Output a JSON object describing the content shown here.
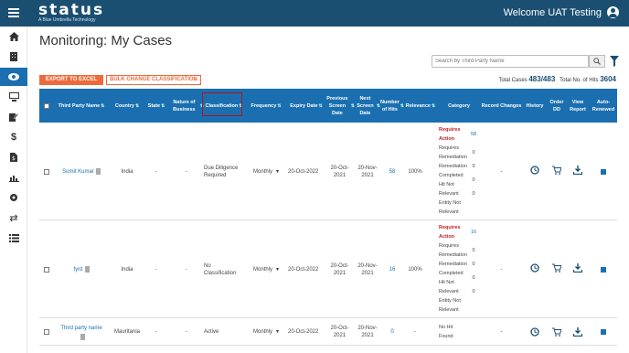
{
  "app": {
    "logo_text": "status",
    "logo_tagline": "A Blue Umbrella Technology",
    "welcome": "Welcome UAT Testing"
  },
  "sidebar": {
    "items": [
      {
        "icon": "home-icon",
        "active": false
      },
      {
        "icon": "building-icon",
        "active": false
      },
      {
        "icon": "eye-icon",
        "active": true
      },
      {
        "icon": "monitor-icon",
        "active": false
      },
      {
        "icon": "edit-document-icon",
        "active": false
      },
      {
        "icon": "dollar-icon",
        "active": false
      },
      {
        "icon": "file-dollar-icon",
        "active": false
      },
      {
        "icon": "bar-chart-icon",
        "active": false
      },
      {
        "icon": "settings-icon",
        "active": false
      },
      {
        "icon": "swap-icon",
        "active": false
      },
      {
        "icon": "list-check-icon",
        "active": false
      }
    ]
  },
  "page": {
    "title": "Monitoring: My Cases"
  },
  "search": {
    "placeholder": "Search by Third Party Name"
  },
  "toolbar": {
    "export_label": "EXPORT TO EXCEL",
    "bulk_label": "BULK CHANGE CLASSIFICATION"
  },
  "totals": {
    "cases_label": "Total Cases",
    "cases_value": "483/483",
    "hits_label": "Total No. of Hits",
    "hits_value": "3604"
  },
  "table": {
    "headers": {
      "third_party_name": "Third Party Name",
      "country": "Country",
      "state": "State",
      "nature": "Nature of Business",
      "classification": "Classification",
      "frequency": "Frequency",
      "expiry": "Expiry Date",
      "prev_screen": "Previous Screen Date",
      "next_screen": "Next Screen Date",
      "hits": "Number of Hits",
      "relevance": "Relevance",
      "category": "Category",
      "record_changes": "Record Changes",
      "history": "History",
      "order_dd": "Order DD",
      "view_report": "View Report",
      "auto_renewed": "Auto-Renewed"
    },
    "rows": [
      {
        "name": "Sumit Kumar",
        "country": "India",
        "state": "-",
        "nature": "-",
        "classification": "Due Diligence Required",
        "frequency": "Monthly",
        "expiry": "20-Oct-2022",
        "prev": "20-Oct-2021",
        "next": "20-Nov-2021",
        "hits": "58",
        "relevance": "100%",
        "categories": [
          {
            "label": "Requires Action",
            "count": "58"
          },
          {
            "label": "Requires Remediation",
            "count": "0"
          },
          {
            "label": "Remediation Completed",
            "count": "0"
          },
          {
            "label": "Hit Not Relevant",
            "count": "0"
          },
          {
            "label": "Entity Not Relevant",
            "count": "0"
          }
        ],
        "record_changes": "-",
        "auto_renewed": true
      },
      {
        "name": "fyrd",
        "country": "India",
        "state": "-",
        "nature": "-",
        "classification": "No Classification",
        "frequency": "Monthly",
        "expiry": "20-Oct-2022",
        "prev": "20-Oct-2021",
        "next": "20-Nov-2021",
        "hits": "16",
        "relevance": "100%",
        "categories": [
          {
            "label": "Requires Action",
            "count": "16"
          },
          {
            "label": "Requires Remediation",
            "count": "0"
          },
          {
            "label": "Remediation Completed",
            "count": "0"
          },
          {
            "label": "Hit Not Relevant",
            "count": "0"
          },
          {
            "label": "Entity Not Relevant",
            "count": "0"
          }
        ],
        "record_changes": "-",
        "auto_renewed": true
      },
      {
        "name": "Third party name",
        "country": "Mauritania",
        "state": "-",
        "nature": "-",
        "classification": "Active",
        "frequency": "Monthly",
        "expiry": "20-Oct-2022",
        "prev": "20-Oct-2021",
        "next": "20-Nov-2021",
        "hits": "0",
        "relevance": "-",
        "categories": [
          {
            "label": "No Hit Found",
            "count": ""
          }
        ],
        "record_changes": "-",
        "auto_renewed": true
      }
    ]
  },
  "colors": {
    "topbar": "#1b4f72",
    "header": "#1b6fb0",
    "accent": "#ee6a3b",
    "requires_action": "#c31e1e",
    "highlight_box": "#b0151b"
  }
}
